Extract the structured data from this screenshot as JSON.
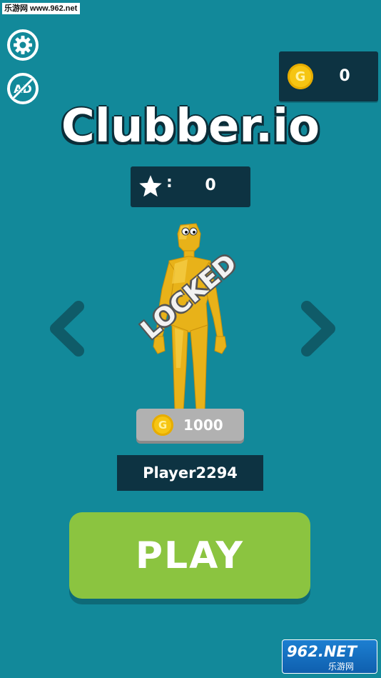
{
  "watermark_top": "乐游网 www.962.net",
  "header": {
    "settings_icon": "gear-icon",
    "no_ads_icon": "no-ads-icon",
    "coins_value": "0"
  },
  "title": "Clubber.io",
  "stars": {
    "value": "0",
    "separator": ":"
  },
  "character": {
    "status_label": "LOCKED",
    "price": "1000",
    "coin_symbol": "G"
  },
  "player_name": "Player2294",
  "play_label": "PLAY",
  "watermark_bottom": {
    "main": "962.NET",
    "sub": "乐游网"
  },
  "colors": {
    "background": "#12899a",
    "panel": "#0d3342",
    "play_button": "#8bc440",
    "coin": "#f6c512",
    "character": "#e8b219"
  }
}
